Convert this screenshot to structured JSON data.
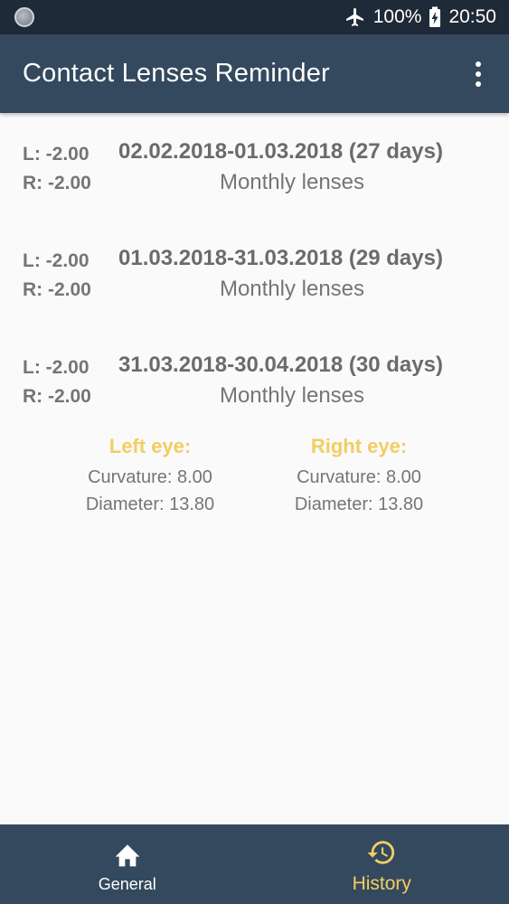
{
  "status_bar": {
    "battery": "100%",
    "time": "20:50"
  },
  "app_bar": {
    "title": "Contact Lenses Reminder"
  },
  "history": [
    {
      "left": "L: -2.00",
      "right": "R: -2.00",
      "period": "02.02.2018-01.03.2018 (27 days)",
      "lens_type": "Monthly lenses"
    },
    {
      "left": "L: -2.00",
      "right": "R: -2.00",
      "period": "01.03.2018-31.03.2018 (29 days)",
      "lens_type": "Monthly lenses"
    },
    {
      "left": "L: -2.00",
      "right": "R: -2.00",
      "period": "31.03.2018-30.04.2018 (30 days)",
      "lens_type": "Monthly lenses"
    }
  ],
  "eyes": {
    "left": {
      "title": "Left eye:",
      "curvature": "Curvature: 8.00",
      "diameter": "Diameter: 13.80"
    },
    "right": {
      "title": "Right eye:",
      "curvature": "Curvature: 8.00",
      "diameter": "Diameter: 13.80"
    }
  },
  "bottom_nav": {
    "general": "General",
    "history": "History"
  },
  "colors": {
    "app_bar": "#34495e",
    "status_bar": "#1f2a38",
    "accent": "#f2cd62",
    "text_gray": "#757575"
  }
}
